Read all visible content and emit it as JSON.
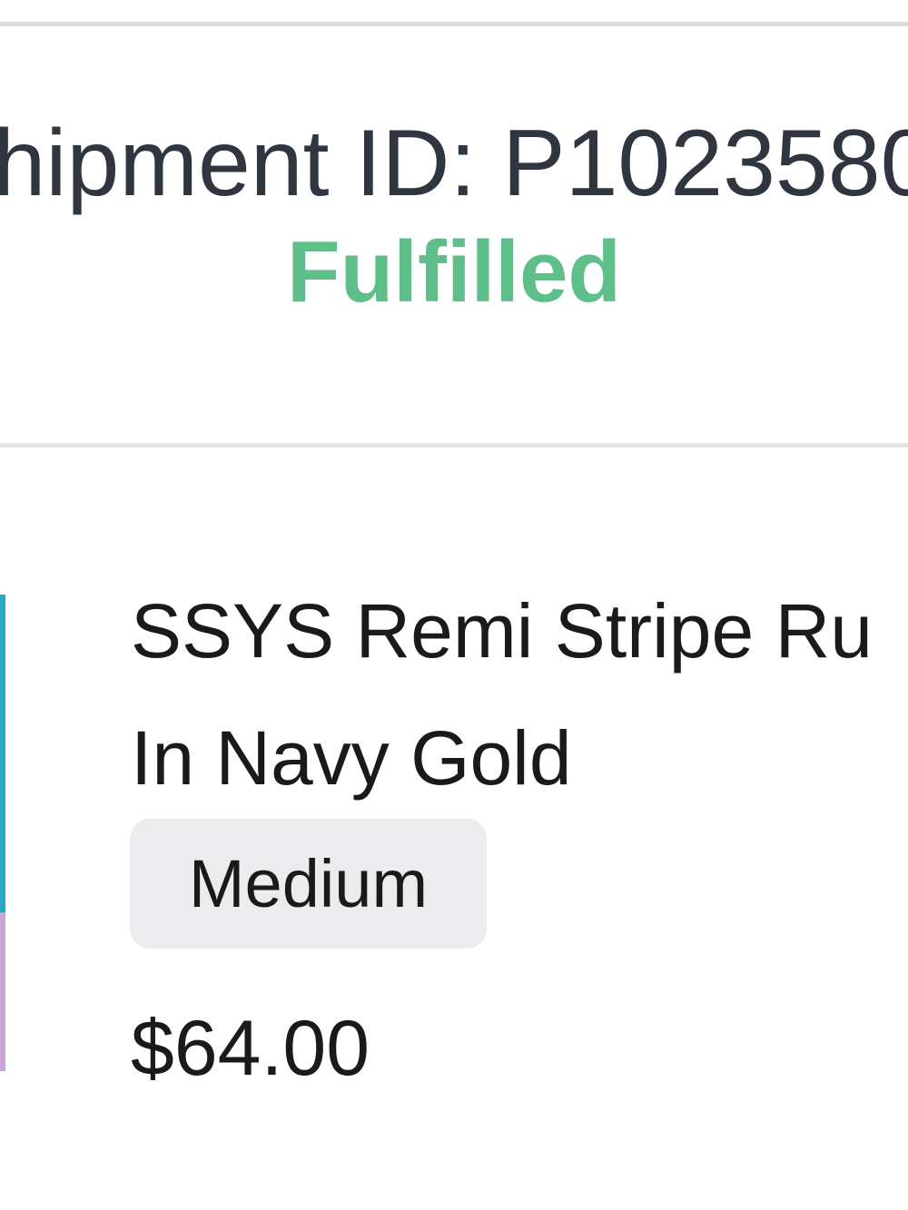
{
  "shipment": {
    "id_text": "hipment ID: P1023580",
    "status": "Fulfilled",
    "status_color": "#5fbf8a"
  },
  "product": {
    "title_line1": "SSYS Remi Stripe Ru",
    "title_line2": "In Navy Gold",
    "variant": "Medium",
    "price": "$64.00",
    "thumbnail_colors": [
      "#27a8c6",
      "#c9a6d6"
    ]
  }
}
